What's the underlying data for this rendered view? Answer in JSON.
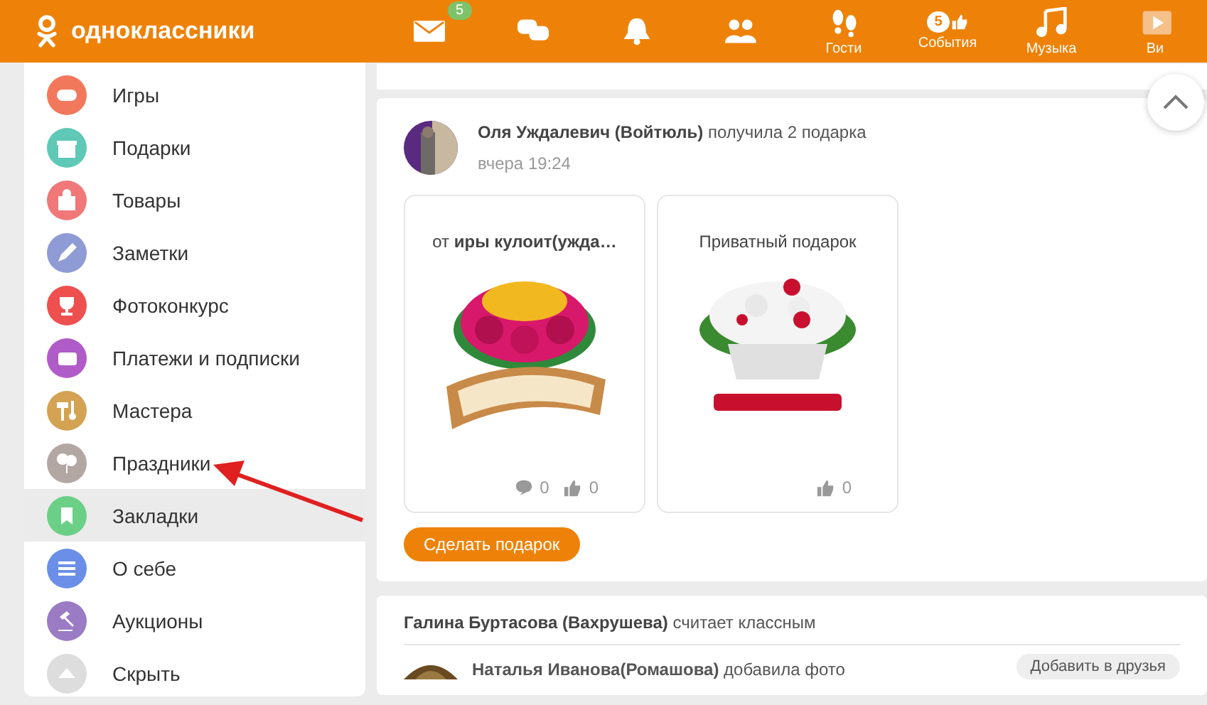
{
  "header": {
    "logo": "одноклассники",
    "nav": [
      {
        "kind": "mail",
        "badge": "5"
      },
      {
        "kind": "chat"
      },
      {
        "kind": "bell"
      },
      {
        "kind": "friends"
      },
      {
        "kind": "footprints",
        "label": "Гости"
      },
      {
        "kind": "events",
        "label": "События",
        "badge": "5"
      },
      {
        "kind": "music",
        "label": "Музыка"
      },
      {
        "kind": "video",
        "label": "Ви"
      }
    ]
  },
  "sidebar": {
    "items": [
      {
        "label": "Игры",
        "color": "#f2785c",
        "highlighted": false
      },
      {
        "label": "Подарки",
        "color": "#5fc8b6",
        "highlighted": false
      },
      {
        "label": "Товары",
        "color": "#f07878",
        "highlighted": false
      },
      {
        "label": "Заметки",
        "color": "#8e9bd4",
        "highlighted": false
      },
      {
        "label": "Фотоконкурс",
        "color": "#ee4f4f",
        "highlighted": false
      },
      {
        "label": "Платежи и подписки",
        "color": "#b05cc8",
        "highlighted": false
      },
      {
        "label": "Мастера",
        "color": "#d3a252",
        "highlighted": false
      },
      {
        "label": "Праздники",
        "color": "#b3a7a3",
        "highlighted": false
      },
      {
        "label": "Закладки",
        "color": "#6ccf86",
        "highlighted": true
      },
      {
        "label": "О себе",
        "color": "#6b8fe8",
        "highlighted": false
      },
      {
        "label": "Аукционы",
        "color": "#9a7bc4",
        "highlighted": false
      },
      {
        "label": "Скрыть",
        "color": "#dddddd",
        "highlighted": false
      }
    ]
  },
  "feed": [
    {
      "kind": "gifts",
      "author": "Оля Уждалевич (Войтюль)",
      "action": "получила 2 подарка",
      "time": "вчера 19:24",
      "gifts": [
        {
          "caption": "от **иры кулоит(ужда…**",
          "stats": [
            {
              "kind": "comment",
              "count": "0"
            },
            {
              "kind": "like",
              "count": "0"
            }
          ]
        },
        {
          "caption": "Приватный подарок",
          "stats": [
            {
              "kind": "like",
              "count": "0"
            }
          ]
        }
      ],
      "button": "Сделать подарок"
    },
    {
      "kind": "liked",
      "author": "Галина Буртасова (Вахрушева)",
      "action": "считает классным",
      "sub_author": "Наталья Иванова(Ромашова)",
      "sub_action": "добавила фото",
      "button": "Добавить в друзья"
    }
  ]
}
